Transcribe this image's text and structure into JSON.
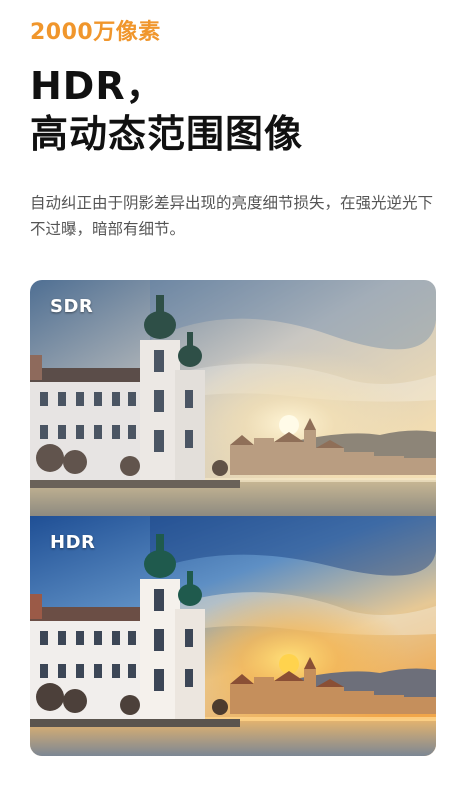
{
  "tagline": "2000万像素",
  "title_line1": "HDR，",
  "title_line2": "高动态范围图像",
  "description": "自动纠正由于阴影差异出现的亮度细节损失，在强光逆光下不过曝，暗部有细节。",
  "comparison": {
    "top_label": "SDR",
    "bottom_label": "HDR"
  },
  "colors": {
    "accent": "#f0962c",
    "title": "#111111",
    "body_text": "#555555"
  }
}
